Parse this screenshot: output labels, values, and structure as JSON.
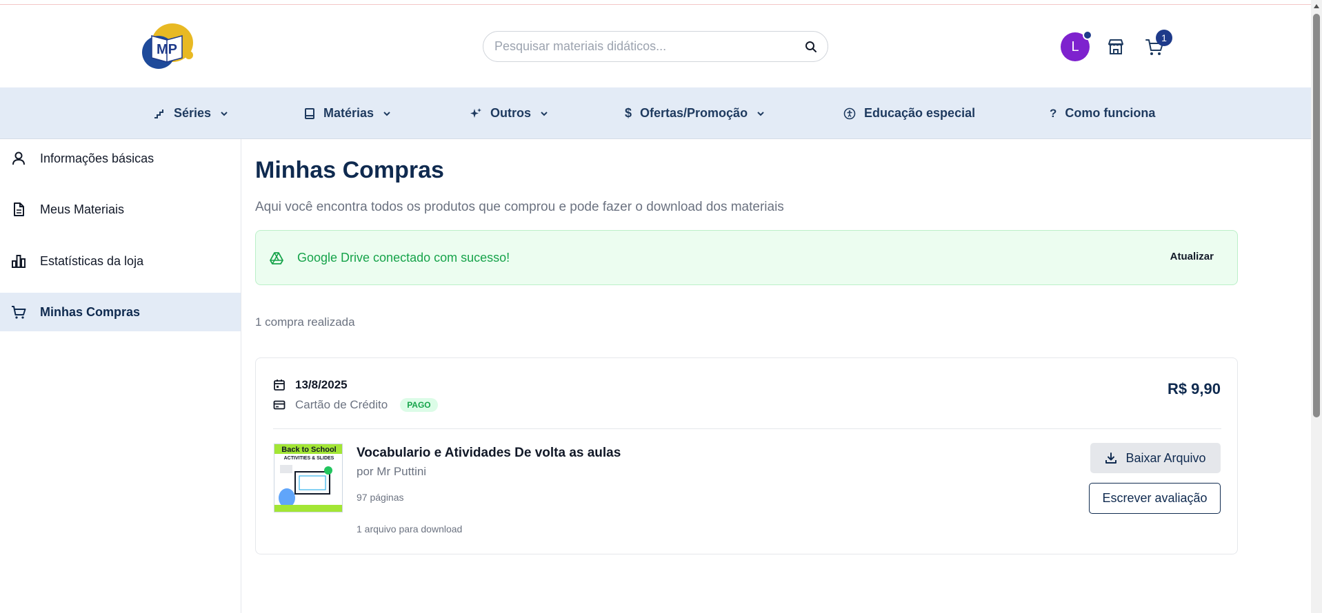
{
  "header": {
    "logo_text": "MP",
    "search_placeholder": "Pesquisar materiais didáticos...",
    "avatar_initial": "L",
    "cart_count": "1"
  },
  "nav": {
    "items": [
      {
        "label": "Séries",
        "icon": "stairs-icon",
        "has_dropdown": true
      },
      {
        "label": "Matérias",
        "icon": "book-icon",
        "has_dropdown": true
      },
      {
        "label": "Outros",
        "icon": "sparkles-icon",
        "has_dropdown": true
      },
      {
        "label": "Ofertas/Promoção",
        "icon": "dollar-icon",
        "has_dropdown": true
      },
      {
        "label": "Educação especial",
        "icon": "accessibility-icon",
        "has_dropdown": false
      },
      {
        "label": "Como funciona",
        "icon": "question-icon",
        "has_dropdown": false
      }
    ]
  },
  "sidebar": {
    "items": [
      {
        "label": "Informações básicas",
        "icon": "user-icon",
        "active": false
      },
      {
        "label": "Meus Materiais",
        "icon": "file-text-icon",
        "active": false
      },
      {
        "label": "Estatísticas da loja",
        "icon": "bar-chart-icon",
        "active": false
      },
      {
        "label": "Minhas Compras",
        "icon": "cart-icon",
        "active": true
      }
    ]
  },
  "main": {
    "title": "Minhas Compras",
    "subtitle": "Aqui você encontra todos os produtos que comprou e pode fazer o download dos materiais",
    "alert": {
      "message": "Google Drive conectado com sucesso!",
      "action_label": "Atualizar"
    },
    "purchase_count": "1 compra realizada",
    "order": {
      "date": "13/8/2025",
      "payment_method": "Cartão de Crédito",
      "status": "PAGO",
      "price": "R$ 9,90",
      "product": {
        "title": "Vocabulario e Atividades De volta as aulas",
        "author": "por Mr Puttini",
        "pages": "97 páginas",
        "files": "1 arquivo para download",
        "thumb_title": "Back to School",
        "thumb_subtitle": "ACTIVITIES & SLIDES"
      },
      "download_label": "Baixar Arquivo",
      "review_label": "Escrever avaliação"
    }
  },
  "colors": {
    "primary": "#0f2a4f",
    "nav_bg": "#e3ebf6",
    "success": "#16a34a",
    "avatar": "#7e22ce",
    "badge": "#1e3a8a"
  }
}
